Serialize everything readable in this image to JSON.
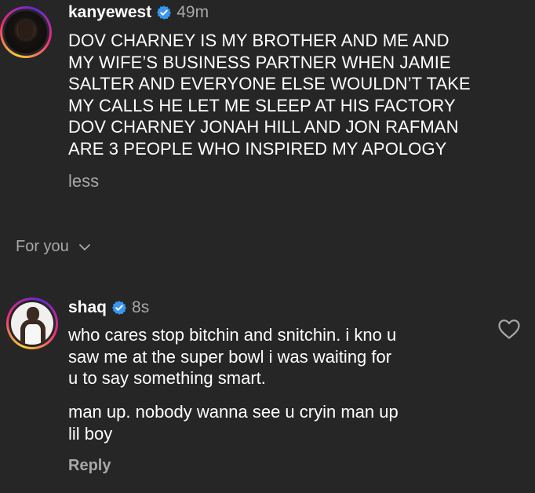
{
  "post": {
    "username": "kanyewest",
    "timestamp": "49m",
    "lines": [
      "DOV CHARNEY IS MY BROTHER AND ME AND",
      "MY WIFE’S BUSINESS PARTNER  WHEN JAMIE",
      "SALTER AND EVERYONE ELSE  WOULDN’T TAKE",
      "MY CALLS HE LET ME SLEEP AT HIS FACTORY",
      "DOV CHARNEY JONAH HILL AND JON RAFMAN",
      "ARE 3 PEOPLE WHO INSPIRED MY APOLOGY"
    ],
    "less_label": "less"
  },
  "filter": {
    "label": "For you"
  },
  "comment": {
    "username": "shaq",
    "timestamp": "8s",
    "lines": [
      "who cares stop bitchin and snitchin. i kno u",
      "saw me at the super bowl i was waiting for",
      "u to say something smart."
    ],
    "lines2": [
      "man up. nobody wanna see u cryin man up",
      "lil boy"
    ],
    "reply_label": "Reply"
  },
  "colors": {
    "background": "#262626",
    "text": "#ffffff",
    "muted": "#a8a8a8",
    "verified": "#3897f0"
  },
  "icons": {
    "verified": "verified-badge-icon",
    "like": "heart-icon",
    "dropdown": "chevron-down-icon"
  }
}
